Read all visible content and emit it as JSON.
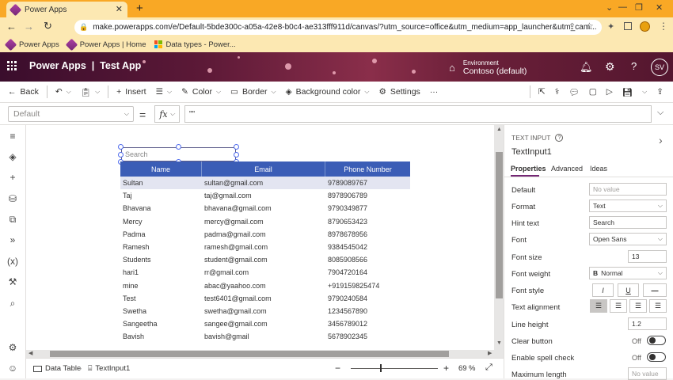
{
  "browser": {
    "tab_title": "Power Apps",
    "url": "make.powerapps.com/e/Default-5bde300c-a05a-42e8-b0c4-ae313fff911d/canvas/?utm_source=office&utm_medium=app_launcher&utm_cam...",
    "bookmarks": [
      {
        "label": "Power Apps"
      },
      {
        "label": "Power Apps | Home"
      },
      {
        "label": "Data types - Power..."
      }
    ]
  },
  "header": {
    "title": "Power Apps  |  Test App",
    "env_label": "Environment",
    "env_value": "Contoso (default)",
    "avatar": "SV"
  },
  "commands": {
    "back": "Back",
    "insert": "Insert",
    "color": "Color",
    "border": "Border",
    "bgcolor": "Background color",
    "settings": "Settings",
    "more": "···"
  },
  "formula": {
    "property": "Default",
    "eq": "=",
    "fx": "fx",
    "value": "\"\""
  },
  "canvas": {
    "search_placeholder": "Search",
    "columns": [
      "Name",
      "Email",
      "Phone Number"
    ],
    "rows": [
      [
        "Sultan",
        "sultan@gmail.com",
        "9789089767"
      ],
      [
        "Taj",
        "taj@gmail.com",
        "8978906789"
      ],
      [
        "Bhavana",
        "bhavana@gmail.com",
        "9790349877"
      ],
      [
        "Mercy",
        "mercy@gmail.com",
        "8790653423"
      ],
      [
        "Padma",
        "padma@gmail.com",
        "8978678956"
      ],
      [
        "Ramesh",
        "ramesh@gmail.com",
        "9384545042"
      ],
      [
        "Students",
        "student@gmail.com",
        "8085908566"
      ],
      [
        "hari1",
        "rr@gmail.com",
        "7904720164"
      ],
      [
        "mine",
        "abac@yaahoo.com",
        "+919159825474"
      ],
      [
        "Test",
        "test6401@gmail.com",
        "9790240584"
      ],
      [
        "Swetha",
        "swetha@gmail.com",
        "1234567890"
      ],
      [
        "Sangeetha",
        "sangee@gmail.com",
        "3456789012"
      ],
      [
        "Bavish",
        "bavish@gmail",
        "5678902345"
      ]
    ]
  },
  "status": {
    "screen1": "Data Table",
    "screen2": "TextInput1",
    "zoom": "69",
    "pct": "%"
  },
  "panel": {
    "type": "TEXT INPUT",
    "name": "TextInput1",
    "tabs": [
      "Properties",
      "Advanced",
      "Ideas"
    ],
    "props": {
      "default_label": "Default",
      "default_value": "No value",
      "format_label": "Format",
      "format_value": "Text",
      "hint_label": "Hint text",
      "hint_value": "Search",
      "font_label": "Font",
      "font_value": "Open Sans",
      "fontsize_label": "Font size",
      "fontsize_value": "13",
      "fontweight_label": "Font weight",
      "fontweight_value": "Normal",
      "fontstyle_label": "Font style",
      "align_label": "Text alignment",
      "lineheight_label": "Line height",
      "lineheight_value": "1.2",
      "clear_label": "Clear button",
      "clear_value": "Off",
      "spell_label": "Enable spell check",
      "spell_value": "Off",
      "maxlen_label": "Maximum length",
      "maxlen_value": "No value"
    }
  },
  "colors": {
    "accent": "#3b5db6",
    "browser_chrome": "#f9a825",
    "selected_row": "#e3e5f1"
  }
}
